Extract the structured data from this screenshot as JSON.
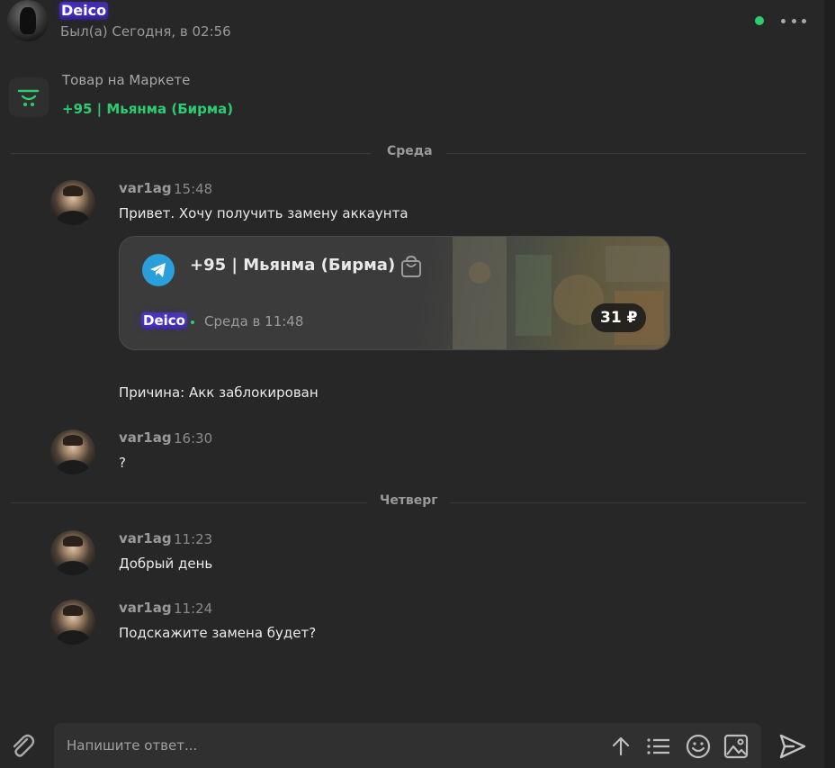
{
  "header": {
    "contact_name": "Deico",
    "status": "Был(а) Сегодня, в 02:56"
  },
  "product": {
    "label": "Товар на Маркете",
    "title": "+95 | Мьянма (Бирма)"
  },
  "separators": {
    "wednesday": "Среда",
    "thursday": "Четверг"
  },
  "messages": [
    {
      "author": "var1ag",
      "time": "15:48",
      "text": "Привет. Хочу получить замену аккаунта"
    },
    {
      "author": "var1ag",
      "time": "16:30",
      "text": "?"
    },
    {
      "author": "var1ag",
      "time": "11:23",
      "text": "Добрый день"
    },
    {
      "author": "var1ag",
      "time": "11:24",
      "text": "Подскажите замена будет?"
    }
  ],
  "card": {
    "title": "+95 | Мьянма (Бирма)",
    "seller": "Deico",
    "date": "Среда в 11:48",
    "price": "31 ₽"
  },
  "reason": "Причина: Акк заблокирован",
  "composer": {
    "placeholder": "Напишите ответ..."
  },
  "colors": {
    "background": "#272727",
    "accent_green": "#2ecc71",
    "telegram_blue": "#2b9fd9",
    "name_glow": "#5a3cff"
  },
  "icons": [
    "more-icon",
    "market-cart-icon",
    "telegram-icon",
    "shopping-bag-icon",
    "paperclip-icon",
    "arrow-up-icon",
    "list-icon",
    "smiley-icon",
    "image-icon",
    "send-icon"
  ]
}
